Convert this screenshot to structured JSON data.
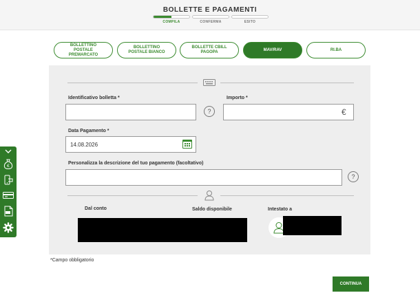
{
  "header": {
    "title": "BOLLETTE E PAGAMENTI",
    "steps": [
      {
        "label": "COMPILA",
        "progress": 0.5
      },
      {
        "label": "CONFERMA",
        "progress": 0
      },
      {
        "label": "ESITO",
        "progress": 0
      }
    ]
  },
  "tabs": [
    {
      "label": "BOLLETTINO POSTALE PREMARCATO"
    },
    {
      "label": "BOLLETTINO POSTALE BIANCO"
    },
    {
      "label": "BOLLETTE CBILL PAGOPA"
    },
    {
      "label": "MAV/RAV",
      "active": true
    },
    {
      "label": "RI.BA"
    }
  ],
  "form": {
    "identificativo_label": "Identificativo bolletta *",
    "identificativo_value": "",
    "importo_label": "Importo *",
    "importo_value": "",
    "currency_symbol": "€",
    "data_label": "Data Pagamento *",
    "data_value": "14.08.2026",
    "descrizione_label": "Personalizza la descrizione del tuo pagamento (facoltativo)",
    "descrizione_value": "",
    "help_symbol": "?"
  },
  "account": {
    "dal_conto_label": "Dal conto",
    "saldo_label": "Saldo disponibile",
    "intestato_label": "Intestato a"
  },
  "footnote": "*Campo obbligatorio",
  "continue_label": "CONTINUA",
  "colors": {
    "brand_green": "#2f7a28",
    "panel_bg": "#eeeeee"
  },
  "sidebar_icons": [
    "chevron-down-icon",
    "money-bag-icon",
    "phone-payment-icon",
    "card-icon",
    "pdf-document-icon",
    "gear-icon"
  ]
}
